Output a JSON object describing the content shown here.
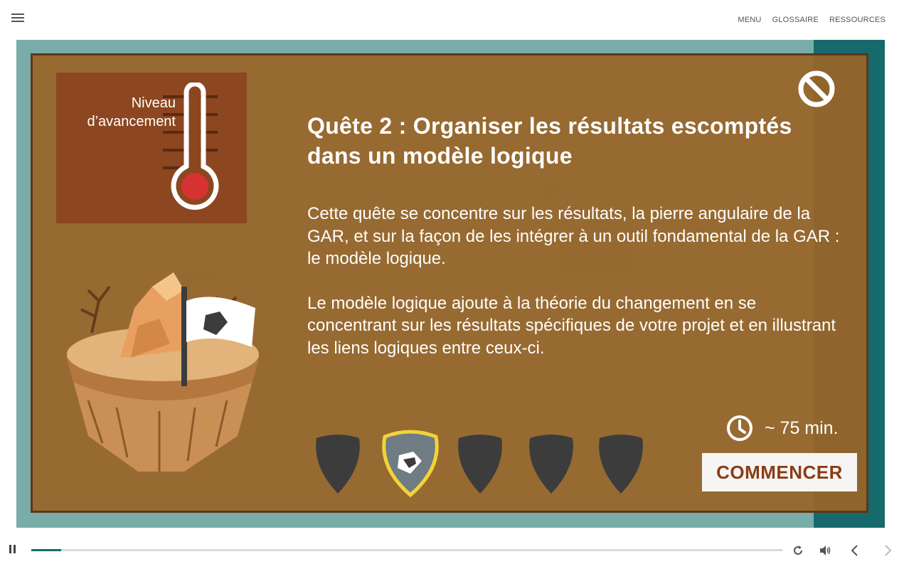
{
  "topbar": {
    "nav": [
      "MENU",
      "GLOSSAIRE",
      "RESSOURCES"
    ]
  },
  "modal": {
    "progress_label": "Niveau d’avancement",
    "title": "Quête 2 : Organiser les résultats escomptés dans un modèle logique",
    "paragraphs": [
      "Cette quête se concentre sur les résultats, la pierre angulaire de la GAR, et sur la façon de les intégrer à un outil fondamental de la GAR : le modèle logique.",
      "Le modèle logique ajoute à la théorie du changement en se concentrant sur les résultats spécifiques de votre projet et en illustrant les liens logiques entre ceux-ci."
    ],
    "duration": "~ 75 min.",
    "start_label": "COMMENCER",
    "badges": [
      {
        "icon": "shield-locked-icon",
        "active": false
      },
      {
        "icon": "chain-link-icon",
        "active": true
      },
      {
        "icon": "shield-locked-icon",
        "active": false
      },
      {
        "icon": "shield-locked-icon",
        "active": false
      },
      {
        "icon": "shield-locked-icon",
        "active": false
      }
    ]
  },
  "player": {
    "progress": 0.04
  },
  "colors": {
    "modal_bg": "#996528",
    "accent": "#1c6a6a",
    "button_text": "#8a3c16"
  }
}
